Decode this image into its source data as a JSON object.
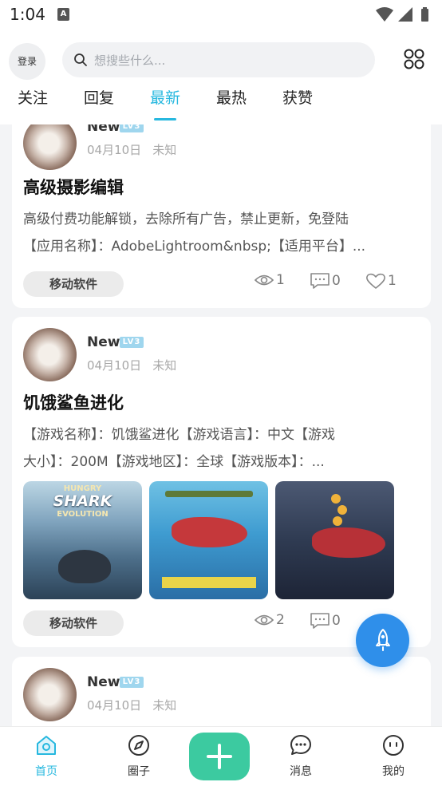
{
  "status_bar": {
    "time": "1:04",
    "notification_icon": "A"
  },
  "header": {
    "login_label": "登录",
    "search_placeholder": "想搜些什么...",
    "tabs": [
      {
        "label": "关注",
        "active": false
      },
      {
        "label": "回复",
        "active": false
      },
      {
        "label": "最新",
        "active": true
      },
      {
        "label": "最热",
        "active": false
      },
      {
        "label": "获赞",
        "active": false
      }
    ]
  },
  "posts": [
    {
      "user": "New",
      "level": "LV3",
      "date": "04月10日",
      "location": "未知",
      "title": "高级摄影编辑",
      "excerpt": [
        "高级付费功能解锁，去除所有广告，禁止更新，免登陆",
        "【应用名称】：AdobeLightroom&nbsp;【适用平台】..."
      ],
      "category": "移动软件",
      "views": "1",
      "comments": "0",
      "likes": "1"
    },
    {
      "user": "New",
      "level": "LV3",
      "date": "04月10日",
      "location": "未知",
      "title": "饥饿鲨鱼进化",
      "excerpt": [
        "【游戏名称】：饥饿鲨进化【游戏语言】：中文【游戏",
        "大小】：200M【游戏地区】：全球【游戏版本】：..."
      ],
      "image_text": {
        "title": "SHARK",
        "subtitle": "EVOLUTION",
        "kicker": "HUNGRY"
      },
      "category": "移动软件",
      "views": "2",
      "comments": "0"
    },
    {
      "user": "New",
      "level": "LV3",
      "date": "04月10日",
      "location": "未知"
    }
  ],
  "bottom_nav": [
    {
      "label": "首页",
      "icon": "home-icon",
      "active": true
    },
    {
      "label": "圈子",
      "icon": "compass-icon",
      "active": false
    },
    {
      "label": "",
      "icon": "plus-icon",
      "active": false
    },
    {
      "label": "消息",
      "icon": "message-icon",
      "active": false
    },
    {
      "label": "我的",
      "icon": "profile-icon",
      "active": false
    }
  ],
  "colors": {
    "accent": "#27b8df",
    "fab": "#2f8fea",
    "add_button": "#3ccaa0",
    "level_badge": "#9fd6ee"
  }
}
